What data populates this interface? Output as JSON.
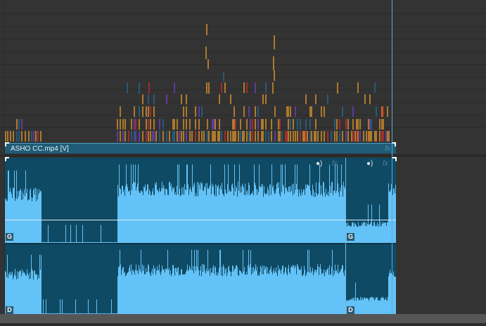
{
  "video_track": {
    "clip_name": "ASHO CC.mp4 [V]",
    "fx_label": "fx"
  },
  "audio_track": {
    "clips": [
      {
        "channel_top": "G",
        "channel_bottom": "D",
        "fx_label": "fx",
        "icon": "audio-wave-icon"
      },
      {
        "channel_top": "G",
        "channel_bottom": "D",
        "fx_label": "fx",
        "icon": "audio-wave-icon"
      }
    ]
  },
  "colors": {
    "background": "#333333",
    "clip_fill": "#0f4a64",
    "waveform": "#63c2f7",
    "playhead": "#5aa6e0",
    "marker_orange": "#f2a22b",
    "marker_blue": "#1f6fa0",
    "marker_red": "#e0282a",
    "marker_purple": "#7a3fd6"
  }
}
